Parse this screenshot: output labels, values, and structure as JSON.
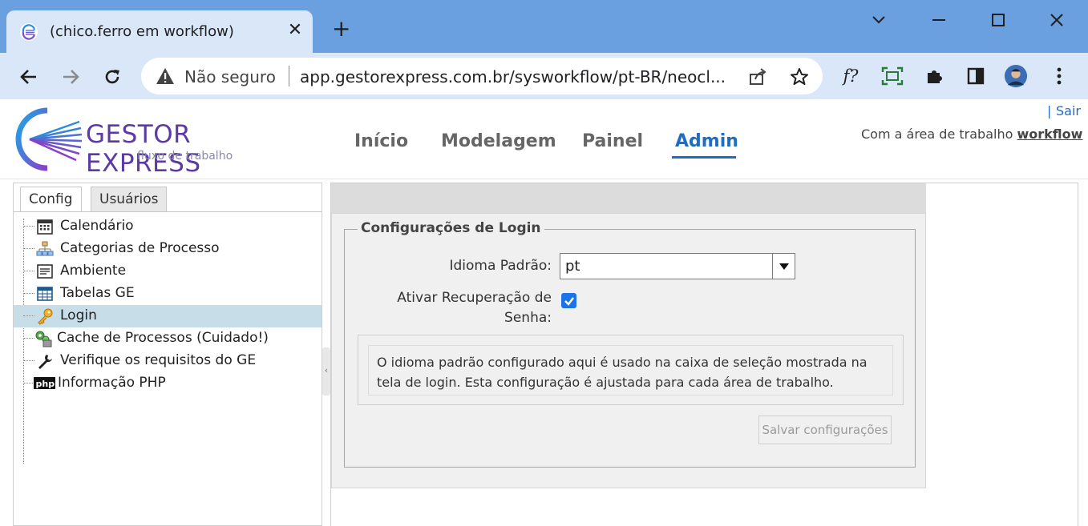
{
  "browser": {
    "tab_title": "(chico.ferro em workflow)",
    "tab_close": "✕",
    "new_tab": "+",
    "security_label": "Não seguro",
    "url": "app.gestorexpress.com.br/sysworkflow/pt-BR/neocl..."
  },
  "header": {
    "logo_title": "GESTOR EXPRESS",
    "logo_subtitle": "fluxo de trabalho",
    "nav": [
      "Início",
      "Modelagem",
      "Painel",
      "Admin"
    ],
    "active_nav": "Admin",
    "logout_sep": "|",
    "logout": "Sair",
    "context_prefix": "Com a área de trabalho",
    "context_workspace": "workflow"
  },
  "sidebar": {
    "tabs": [
      "Config",
      "Usuários"
    ],
    "items": [
      {
        "label": "Calendário",
        "icon": "calendar-icon"
      },
      {
        "label": "Categorias de Processo",
        "icon": "process-categories-icon"
      },
      {
        "label": "Ambiente",
        "icon": "environment-icon"
      },
      {
        "label": "Tabelas GE",
        "icon": "tables-icon"
      },
      {
        "label": "Login",
        "icon": "key-icon",
        "selected": true
      },
      {
        "label": "Cache de Processos (Cuidado!)",
        "icon": "cache-icon"
      },
      {
        "label": "Verifique os requisitos do GE",
        "icon": "wrench-icon"
      },
      {
        "label": "Informação PHP",
        "icon": "php-icon"
      }
    ]
  },
  "login_settings": {
    "legend": "Configurações de Login",
    "language_label": "Idioma Padrão:",
    "language_value": "pt",
    "recovery_label_line1": "Ativar Recuperação de",
    "recovery_label_line2": "Senha:",
    "recovery_checked": true,
    "info_text": "O idioma padrão configurado aqui é usado na caixa de seleção mostrada na tela de login. Esta configuração é ajustada para cada área de trabalho.",
    "save_button": "Salvar configurações"
  },
  "colors": {
    "titlebar": "#6ba0e0",
    "toolbar": "#d9e7f8",
    "accent": "#1f6cc5",
    "selected_row": "#c7dde8",
    "checkbox": "#1a73e8"
  }
}
